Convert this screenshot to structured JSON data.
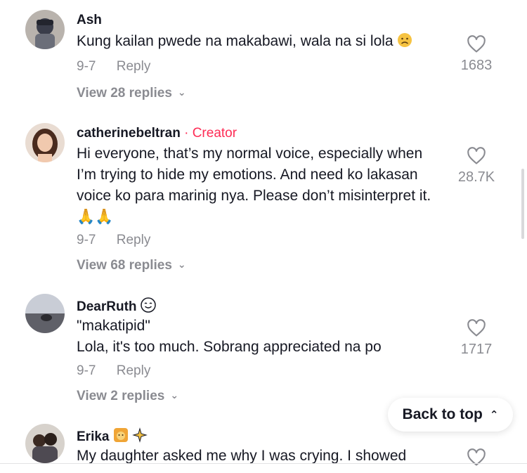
{
  "comments": [
    {
      "username": "Ash",
      "text": "Kung kailan pwede na makabawi, wala na si lola",
      "date": "9-7",
      "reply_label": "Reply",
      "likes": "1683",
      "view_replies": "View 28 replies"
    },
    {
      "username": "catherinebeltran",
      "badge": "· Creator",
      "text": "Hi everyone, that’s my normal voice, especially when I’m trying to hide my emotions. And need ko lakasan voice ko para marinig nya. Please don’t misinterpret it. 🙏🙏",
      "date": "9-7",
      "reply_label": "Reply",
      "likes": "28.7K",
      "view_replies": "View 68 replies"
    },
    {
      "username": "DearRuth",
      "text_line1": "\"makatipid\"",
      "text_line2": "Lola, it's too much. Sobrang appreciated na po",
      "date": "9-7",
      "reply_label": "Reply",
      "likes": "1717",
      "view_replies": "View 2 replies"
    },
    {
      "username": "Erika",
      "text": "My daughter asked me why I was crying. I showed"
    }
  ],
  "back_to_top": "Back to top",
  "colors": {
    "creator": "#fe2c55",
    "muted": "#8a8b91",
    "text": "#161823"
  },
  "icons": [
    "heart-outline-icon",
    "chevron-down-icon",
    "double-chevron-up-icon"
  ]
}
